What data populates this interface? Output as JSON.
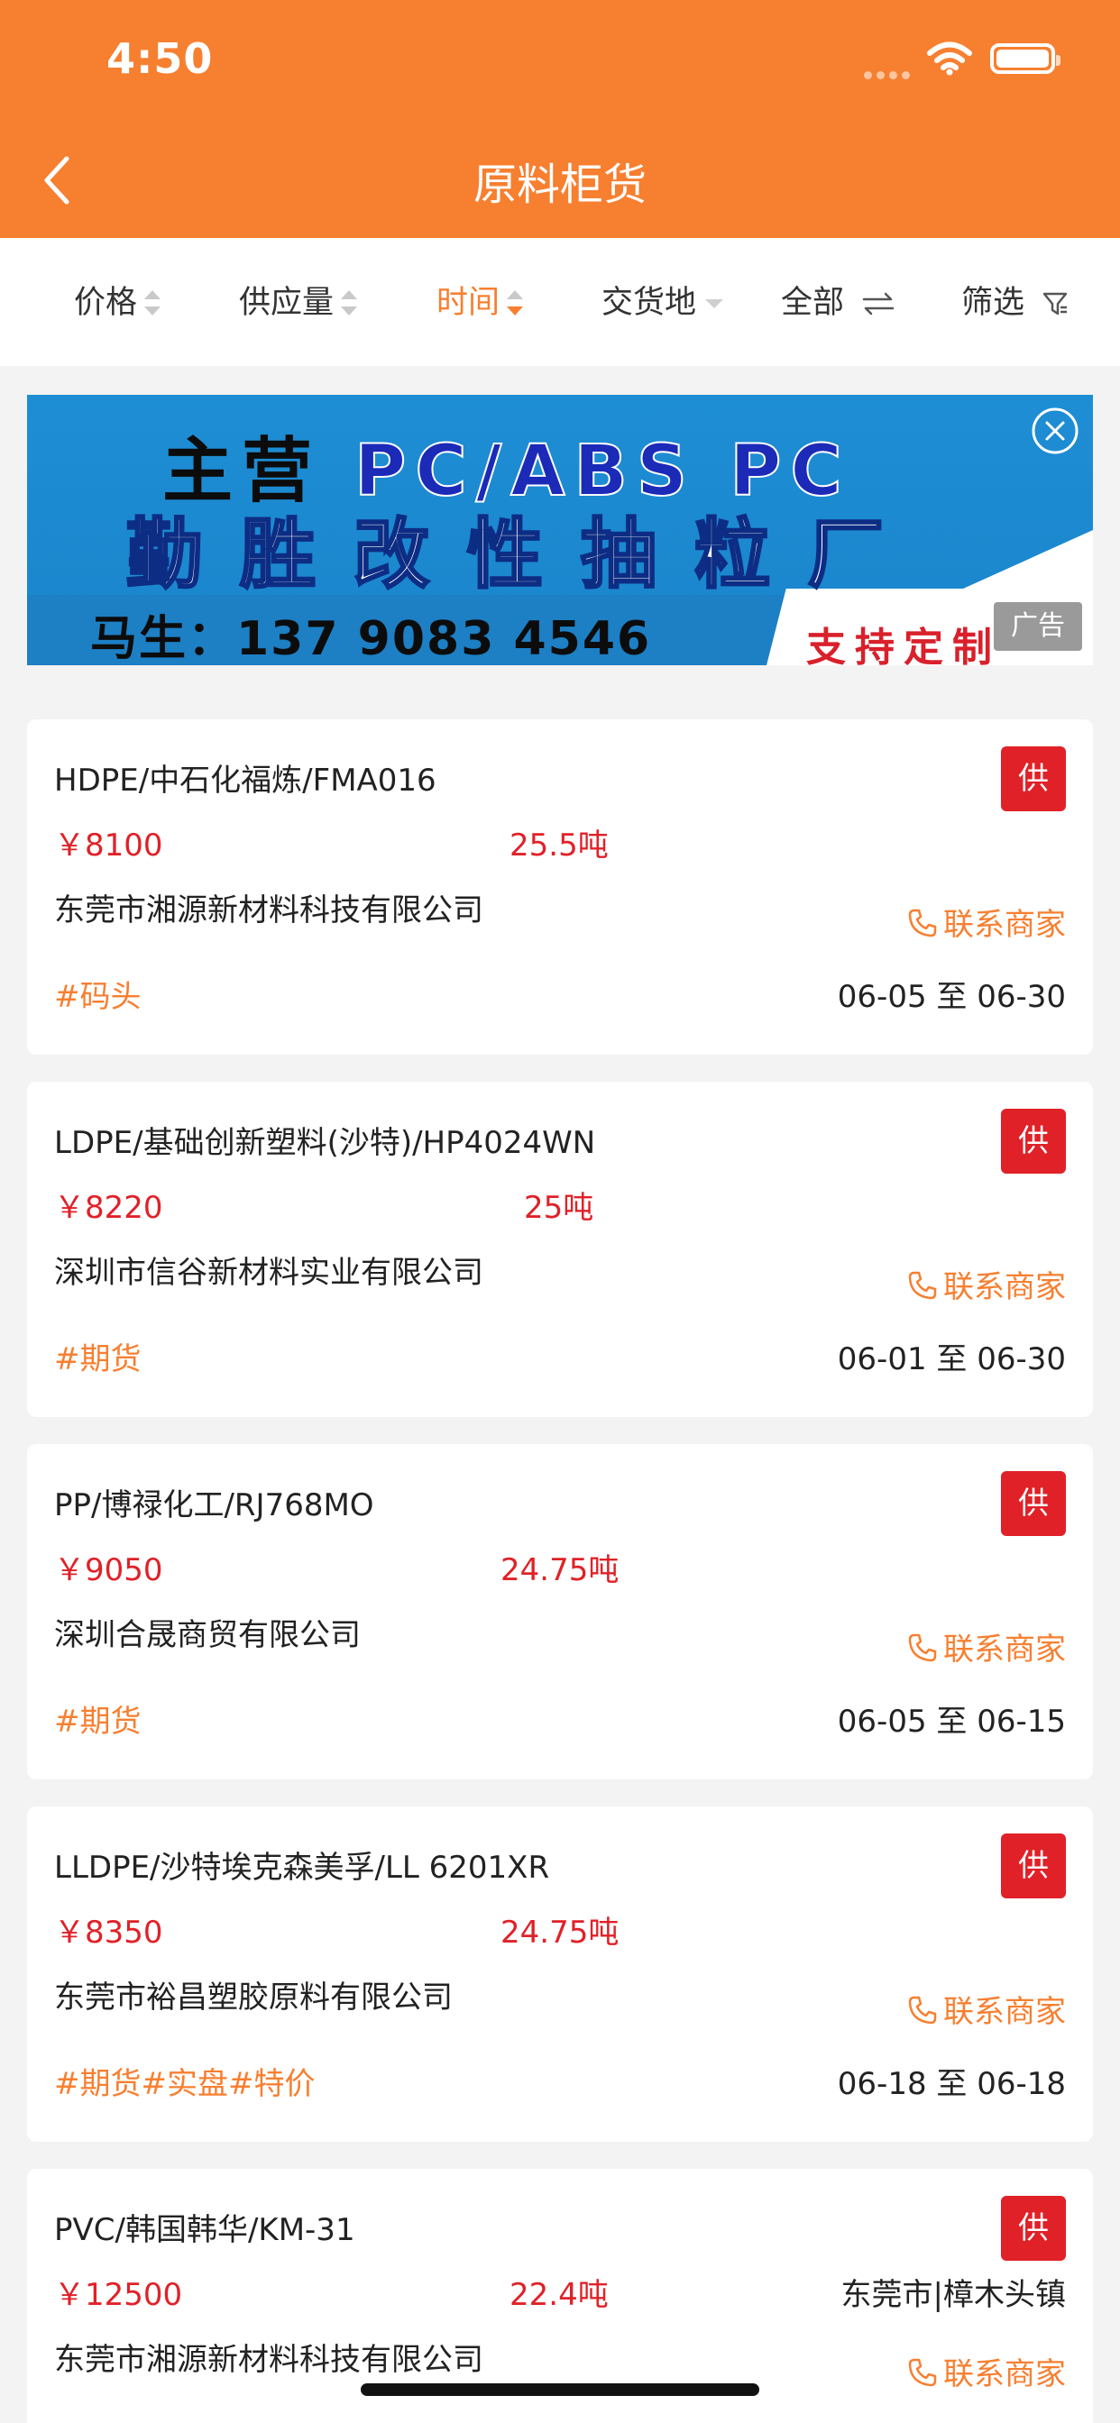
{
  "status_bar": {
    "time": "4:50"
  },
  "nav": {
    "title": "原料柜货"
  },
  "filters": [
    {
      "label": "价格",
      "type": "sort",
      "active": false
    },
    {
      "label": "供应量",
      "type": "sort",
      "active": false
    },
    {
      "label": "时间",
      "type": "sort",
      "active": true
    },
    {
      "label": "交货地",
      "type": "dropdown",
      "active": false
    },
    {
      "label": "全部",
      "type": "toggle",
      "active": false
    },
    {
      "label": "筛选",
      "type": "filter",
      "active": false
    }
  ],
  "ad": {
    "line1_prefix": "主营",
    "line1_products": "PC/ABS PC",
    "line2": "勤胜改性抽粒厂",
    "line3": "马生：137 9083 4546",
    "line4": "支持定制",
    "tag": "广告"
  },
  "listings": [
    {
      "name": "HDPE/中石化福炼/FMA016",
      "badge": "供",
      "price": "￥8100",
      "qty": "25.5吨",
      "location": "",
      "company": "东莞市湘源新材料科技有限公司",
      "contact": "联系商家",
      "tags": "#码头",
      "dates": "06-05 至 06-30"
    },
    {
      "name": "LDPE/基础创新塑料(沙特)/HP4024WN",
      "badge": "供",
      "price": "￥8220",
      "qty": "25吨",
      "location": "",
      "company": "深圳市信谷新材料实业有限公司",
      "contact": "联系商家",
      "tags": "#期货",
      "dates": "06-01 至 06-30"
    },
    {
      "name": "PP/博禄化工/RJ768MO",
      "badge": "供",
      "price": "￥9050",
      "qty": "24.75吨",
      "location": "",
      "company": "深圳合晟商贸有限公司",
      "contact": "联系商家",
      "tags": "#期货",
      "dates": "06-05 至 06-15"
    },
    {
      "name": "LLDPE/沙特埃克森美孚/LL 6201XR",
      "badge": "供",
      "price": "￥8350",
      "qty": "24.75吨",
      "location": "",
      "company": "东莞市裕昌塑胶原料有限公司",
      "contact": "联系商家",
      "tags": "#期货#实盘#特价",
      "dates": "06-18 至 06-18"
    },
    {
      "name": "PVC/韩国韩华/KM-31",
      "badge": "供",
      "price": "￥12500",
      "qty": "22.4吨",
      "location": "东莞市|樟木头镇",
      "company": "东莞市湘源新材料科技有限公司",
      "contact": "联系商家",
      "tags": "",
      "dates": ""
    }
  ],
  "colors": {
    "accent": "#f77f30",
    "price": "#e02128",
    "badge": "#e02128"
  }
}
